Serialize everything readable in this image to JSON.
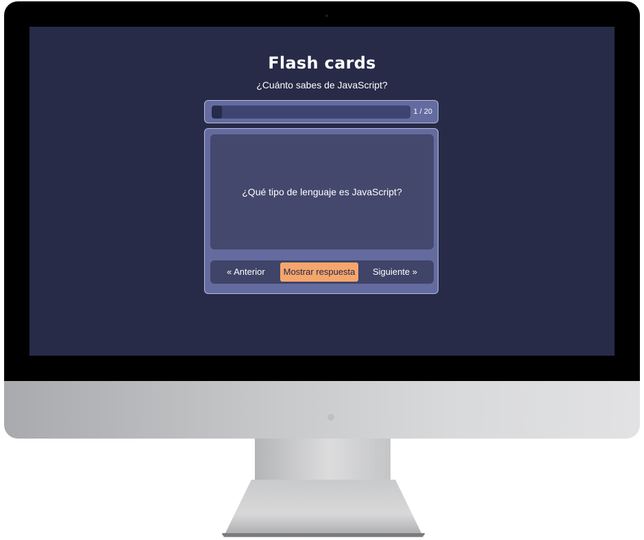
{
  "app": {
    "title": "Flash cards",
    "subtitle": "¿Cuánto sabes de JavaScript?"
  },
  "progress": {
    "current": 1,
    "total": 20,
    "label": "1 / 20"
  },
  "card": {
    "question": "¿Qué tipo de lenguaje es JavaScript?"
  },
  "nav": {
    "prev_label": "« Anterior",
    "show_answer_label": "Mostrar respuesta",
    "next_label": "Siguiente »"
  },
  "colors": {
    "background": "#272b47",
    "panel": "#646b9f",
    "card": "#44486c",
    "accent": "#f5a66c"
  }
}
